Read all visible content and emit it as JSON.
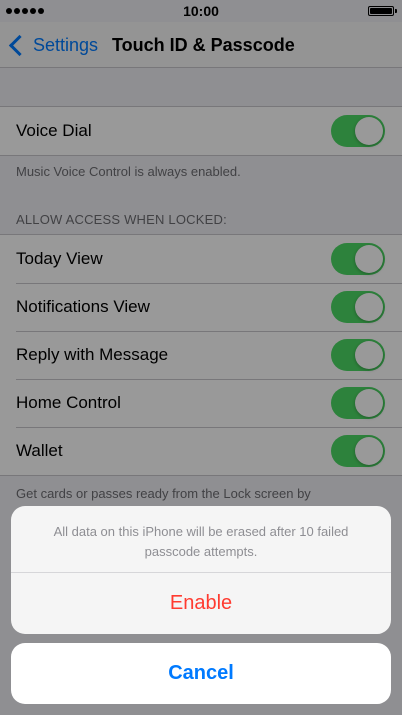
{
  "status_bar": {
    "time": "10:00"
  },
  "nav": {
    "back_label": "Settings",
    "title": "Touch ID & Passcode"
  },
  "voice_dial": {
    "label": "Voice Dial",
    "enabled": true,
    "footer": "Music Voice Control is always enabled."
  },
  "locked_access": {
    "header": "ALLOW ACCESS WHEN LOCKED:",
    "items": [
      {
        "label": "Today View",
        "enabled": true
      },
      {
        "label": "Notifications View",
        "enabled": true
      },
      {
        "label": "Reply with Message",
        "enabled": true
      },
      {
        "label": "Home Control",
        "enabled": true
      },
      {
        "label": "Wallet",
        "enabled": true
      }
    ],
    "footer": "Get cards or passes ready from the Lock screen by"
  },
  "action_sheet": {
    "message": "All data on this iPhone will be erased after 10 failed passcode attempts.",
    "enable_label": "Enable",
    "cancel_label": "Cancel"
  },
  "colors": {
    "accent": "#007aff",
    "destructive": "#ff3b30",
    "toggle_on": "#4cd964"
  }
}
